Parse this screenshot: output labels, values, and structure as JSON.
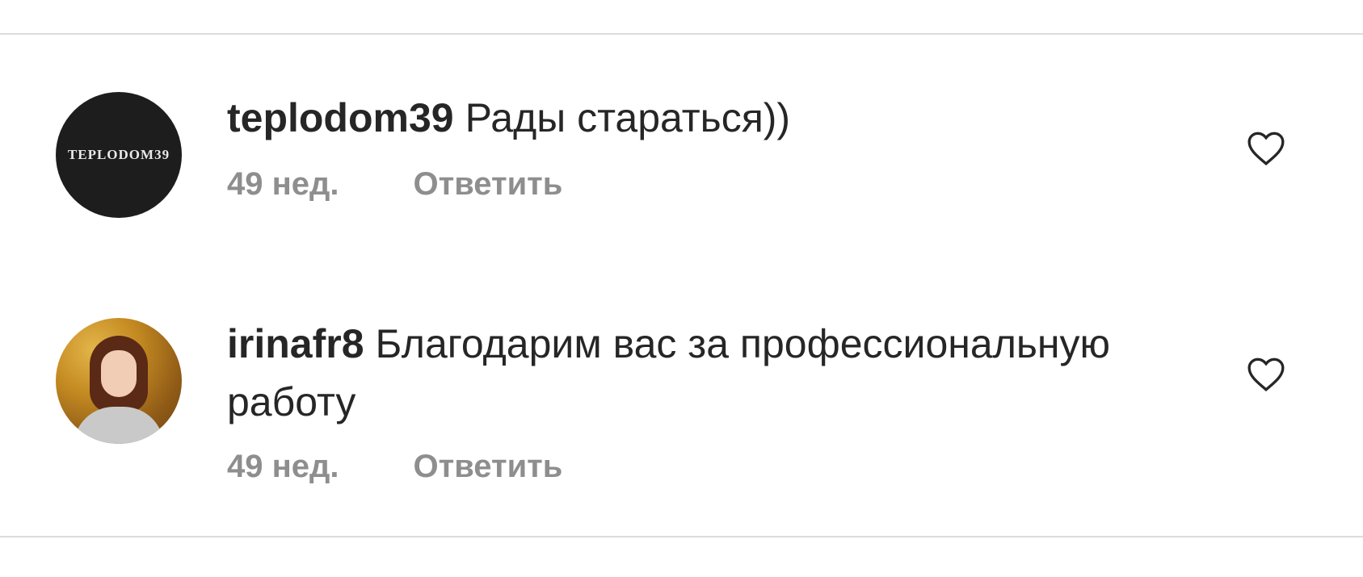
{
  "comments": [
    {
      "avatar_text": "TEPLODOM39",
      "username": "teplodom39",
      "text": "Рады стараться))",
      "time": "49 нед.",
      "reply_label": "Ответить",
      "like_icon": "heart-outline-icon"
    },
    {
      "username": "irinafr8",
      "text": "Благодарим вас за профессиональную работу",
      "time": "49 нед.",
      "reply_label": "Ответить",
      "like_icon": "heart-outline-icon"
    }
  ],
  "colors": {
    "text": "#262626",
    "muted": "#8e8e8e",
    "divider": "#dcdcdc"
  }
}
